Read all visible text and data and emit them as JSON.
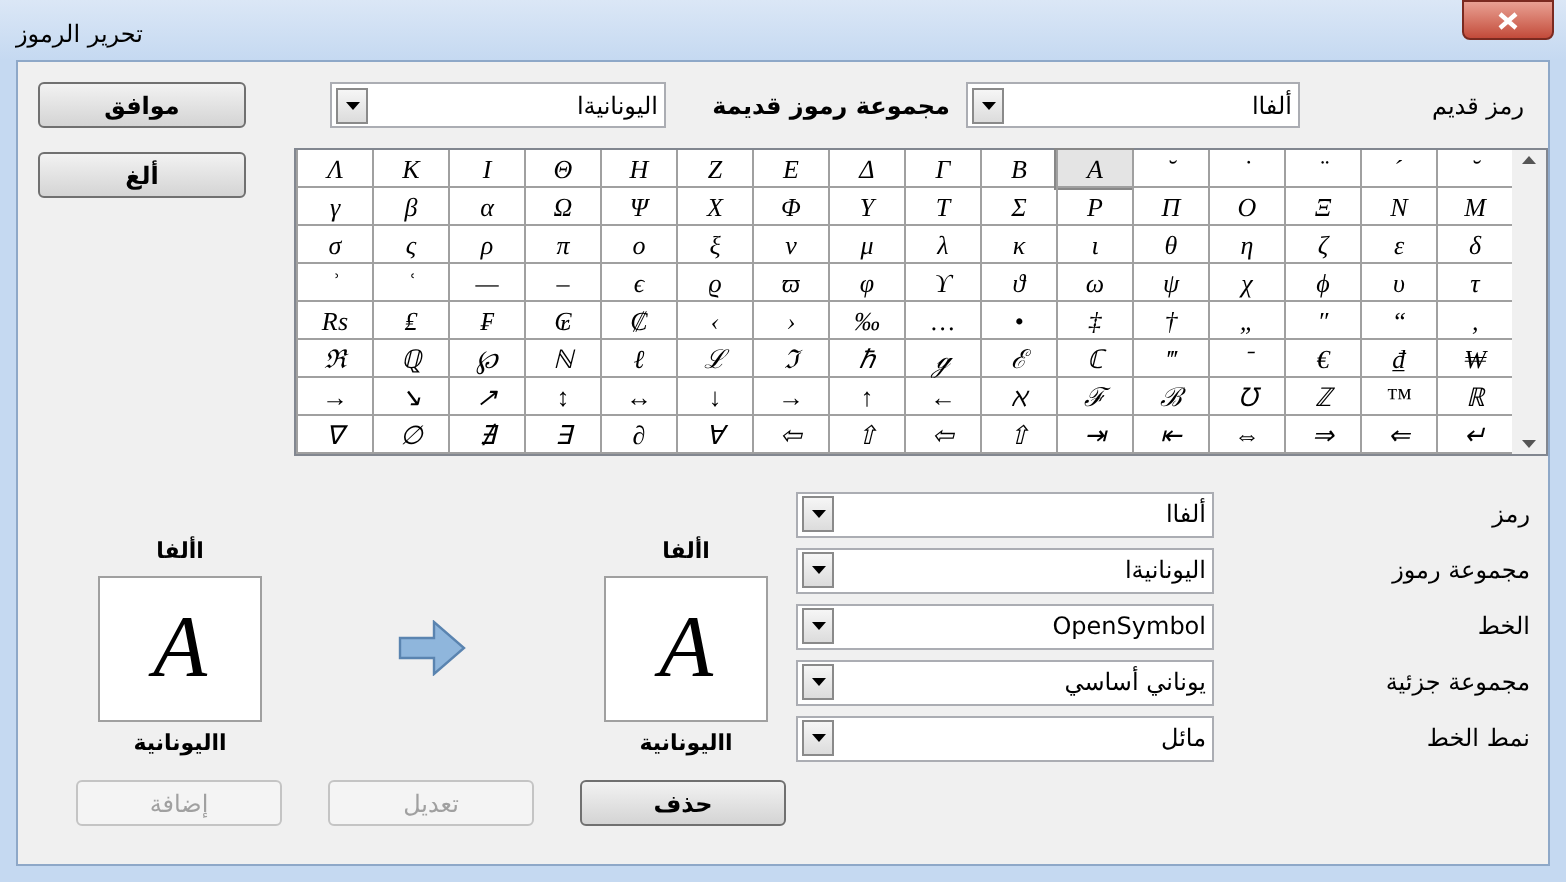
{
  "window": {
    "title": "تحرير الرموز"
  },
  "top_bar": {
    "old_symbol_label": "رمز قديم",
    "old_symbol_combo": {
      "value": "ألفاا"
    },
    "old_set_label": "مجموعة رموز قديمة",
    "subset_combo": {
      "value": "اليونانيةا"
    },
    "ok_button": "موافق"
  },
  "cancel_button": "ألغ",
  "symbol_grid": {
    "rows": [
      [
        {
          "s": "˘",
          "selected": false
        },
        {
          "s": "ˊ",
          "selected": false
        },
        {
          "s": "¨",
          "selected": false
        },
        {
          "s": "˙",
          "selected": false
        },
        {
          "s": "˘",
          "selected": false
        },
        {
          "s": "Α",
          "selected": true
        },
        {
          "s": "Β",
          "selected": false
        },
        {
          "s": "Γ",
          "selected": false
        },
        {
          "s": "Δ",
          "selected": false
        },
        {
          "s": "Ε",
          "selected": false
        },
        {
          "s": "Ζ",
          "selected": false
        },
        {
          "s": "Η",
          "selected": false
        },
        {
          "s": "Θ",
          "selected": false
        },
        {
          "s": "Ι",
          "selected": false
        },
        {
          "s": "Κ",
          "selected": false
        },
        {
          "s": "Λ",
          "selected": false
        }
      ],
      [
        {
          "s": "Μ",
          "selected": false
        },
        {
          "s": "Ν",
          "selected": false
        },
        {
          "s": "Ξ",
          "selected": false
        },
        {
          "s": "Ο",
          "selected": false
        },
        {
          "s": "Π",
          "selected": false
        },
        {
          "s": "Ρ",
          "selected": false
        },
        {
          "s": "Σ",
          "selected": false
        },
        {
          "s": "Τ",
          "selected": false
        },
        {
          "s": "Υ",
          "selected": false
        },
        {
          "s": "Φ",
          "selected": false
        },
        {
          "s": "Χ",
          "selected": false
        },
        {
          "s": "Ψ",
          "selected": false
        },
        {
          "s": "Ω",
          "selected": false
        },
        {
          "s": "α",
          "selected": false
        },
        {
          "s": "β",
          "selected": false
        },
        {
          "s": "γ",
          "selected": false
        }
      ],
      [
        {
          "s": "δ",
          "selected": false
        },
        {
          "s": "ε",
          "selected": false
        },
        {
          "s": "ζ",
          "selected": false
        },
        {
          "s": "η",
          "selected": false
        },
        {
          "s": "θ",
          "selected": false
        },
        {
          "s": "ι",
          "selected": false
        },
        {
          "s": "κ",
          "selected": false
        },
        {
          "s": "λ",
          "selected": false
        },
        {
          "s": "μ",
          "selected": false
        },
        {
          "s": "ν",
          "selected": false
        },
        {
          "s": "ξ",
          "selected": false
        },
        {
          "s": "ο",
          "selected": false
        },
        {
          "s": "π",
          "selected": false
        },
        {
          "s": "ρ",
          "selected": false
        },
        {
          "s": "ς",
          "selected": false
        },
        {
          "s": "σ",
          "selected": false
        }
      ],
      [
        {
          "s": "τ",
          "selected": false
        },
        {
          "s": "υ",
          "selected": false
        },
        {
          "s": "ϕ",
          "selected": false
        },
        {
          "s": "χ",
          "selected": false
        },
        {
          "s": "ψ",
          "selected": false
        },
        {
          "s": "ω",
          "selected": false
        },
        {
          "s": "ϑ",
          "selected": false
        },
        {
          "s": "ϒ",
          "selected": false
        },
        {
          "s": "φ",
          "selected": false
        },
        {
          "s": "ϖ",
          "selected": false
        },
        {
          "s": "ϱ",
          "selected": false
        },
        {
          "s": "ϵ",
          "selected": false
        },
        {
          "s": "–",
          "selected": false
        },
        {
          "s": "—",
          "selected": false
        },
        {
          "s": "ʿ",
          "selected": false
        },
        {
          "s": "ʾ",
          "selected": false
        }
      ],
      [
        {
          "s": "‚",
          "selected": false
        },
        {
          "s": "“",
          "selected": false
        },
        {
          "s": "″",
          "selected": false
        },
        {
          "s": "„",
          "selected": false
        },
        {
          "s": "†",
          "selected": false
        },
        {
          "s": "‡",
          "selected": false
        },
        {
          "s": "•",
          "selected": false
        },
        {
          "s": "…",
          "selected": false
        },
        {
          "s": "‰",
          "selected": false
        },
        {
          "s": "›",
          "selected": false
        },
        {
          "s": "‹",
          "selected": false
        },
        {
          "s": "₡",
          "selected": false
        },
        {
          "s": "₢",
          "selected": false
        },
        {
          "s": "₣",
          "selected": false
        },
        {
          "s": "₤",
          "selected": false
        },
        {
          "s": "₨",
          "selected": false
        }
      ],
      [
        {
          "s": "₩",
          "selected": false
        },
        {
          "s": "₫",
          "selected": false
        },
        {
          "s": "€",
          "selected": false
        },
        {
          "s": "⁻",
          "selected": false
        },
        {
          "s": "‴",
          "selected": false
        },
        {
          "s": "ℂ",
          "selected": false
        },
        {
          "s": "ℰ",
          "selected": false
        },
        {
          "s": "ℊ",
          "selected": false
        },
        {
          "s": "ℏ",
          "selected": false
        },
        {
          "s": "ℑ",
          "selected": false
        },
        {
          "s": "ℒ",
          "selected": false
        },
        {
          "s": "ℓ",
          "selected": false
        },
        {
          "s": "ℕ",
          "selected": false
        },
        {
          "s": "℘",
          "selected": false
        },
        {
          "s": "ℚ",
          "selected": false
        },
        {
          "s": "ℜ",
          "selected": false
        }
      ],
      [
        {
          "s": "ℝ",
          "selected": false
        },
        {
          "s": "™",
          "selected": false
        },
        {
          "s": "ℤ",
          "selected": false
        },
        {
          "s": "℧",
          "selected": false
        },
        {
          "s": "ℬ",
          "selected": false
        },
        {
          "s": "ℱ",
          "selected": false
        },
        {
          "s": "ℵ",
          "selected": false
        },
        {
          "s": "←",
          "selected": false
        },
        {
          "s": "↑",
          "selected": false
        },
        {
          "s": "→",
          "selected": false
        },
        {
          "s": "↓",
          "selected": false
        },
        {
          "s": "↔",
          "selected": false
        },
        {
          "s": "↕",
          "selected": false
        },
        {
          "s": "↗",
          "selected": false
        },
        {
          "s": "↘",
          "selected": false
        },
        {
          "s": "→",
          "selected": false
        }
      ],
      [
        {
          "s": "↵",
          "selected": false
        },
        {
          "s": "⇐",
          "selected": false
        },
        {
          "s": "⇒",
          "selected": false
        },
        {
          "s": "⇔",
          "selected": false
        },
        {
          "s": "⇤",
          "selected": false
        },
        {
          "s": "⇥",
          "selected": false
        },
        {
          "s": "⇧",
          "selected": false
        },
        {
          "s": "⇦",
          "selected": false
        },
        {
          "s": "⇧",
          "selected": false
        },
        {
          "s": "⇦",
          "selected": false
        },
        {
          "s": "∀",
          "selected": false
        },
        {
          "s": "∂",
          "selected": false
        },
        {
          "s": "∃",
          "selected": false
        },
        {
          "s": "∄",
          "selected": false
        },
        {
          "s": "∅",
          "selected": false
        },
        {
          "s": "∇",
          "selected": false
        }
      ]
    ]
  },
  "form": [
    {
      "label": "رمز",
      "value": "ألفاا"
    },
    {
      "label": "مجموعة رموز",
      "value": "اليونانيةا"
    },
    {
      "label": "الخط",
      "value": "OpenSymbol"
    },
    {
      "label": "مجموعة جزئية",
      "value": "يوناني أساسي"
    },
    {
      "label": "نمط الخط",
      "value": "مائل"
    }
  ],
  "previews": [
    {
      "name": "األفا",
      "glyph": "Α",
      "set": "االيونانية"
    },
    {
      "name": "األفا",
      "glyph": "Α",
      "set": "االيونانية"
    }
  ],
  "action_buttons": [
    {
      "label": "حذف",
      "disabled": false
    },
    {
      "label": "تعديل",
      "disabled": true
    },
    {
      "label": "إضافة",
      "disabled": true
    }
  ]
}
